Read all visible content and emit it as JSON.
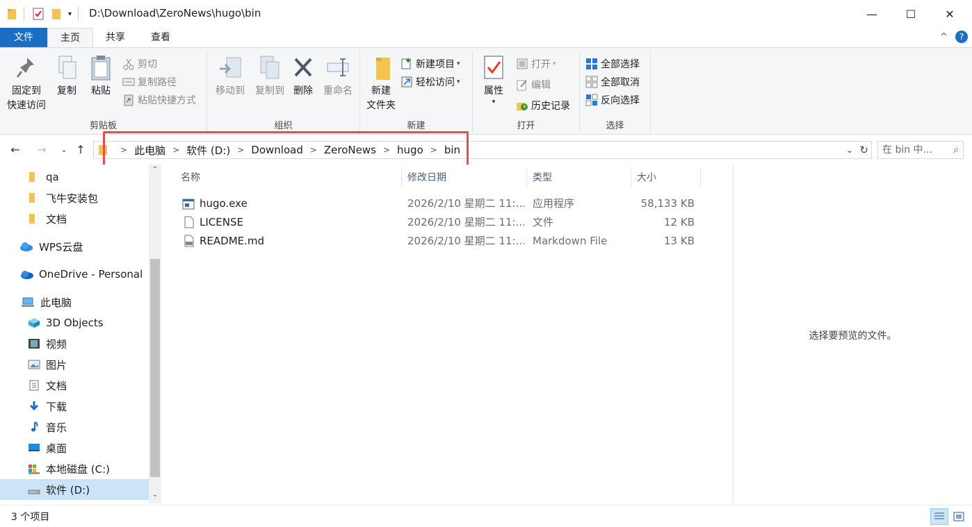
{
  "titlebar": {
    "path": "D:\\Download\\ZeroNews\\hugo\\bin",
    "minimize": "—",
    "maximize": "☐",
    "close": "✕"
  },
  "ribbon_tabs": {
    "file": "文件",
    "home": "主页",
    "share": "共享",
    "view": "查看",
    "collapse": "^",
    "help": "?"
  },
  "ribbon": {
    "clipboard": {
      "label": "剪贴板",
      "pin_line1": "固定到",
      "pin_line2": "快速访问",
      "copy": "复制",
      "paste": "粘贴",
      "cut": "剪切",
      "copy_path": "复制路径",
      "paste_shortcut": "粘贴快捷方式"
    },
    "organize": {
      "label": "组织",
      "move_to": "移动到",
      "copy_to": "复制到",
      "delete": "删除",
      "rename": "重命名"
    },
    "new": {
      "label": "新建",
      "new_folder_line1": "新建",
      "new_folder_line2": "文件夹",
      "new_item": "新建项目",
      "easy_access": "轻松访问"
    },
    "open": {
      "label": "打开",
      "properties": "属性",
      "open": "打开",
      "edit": "编辑",
      "history": "历史记录"
    },
    "select": {
      "label": "选择",
      "select_all": "全部选择",
      "select_none": "全部取消",
      "invert": "反向选择"
    }
  },
  "address": {
    "crumbs": [
      "此电脑",
      "软件 (D:)",
      "Download",
      "ZeroNews",
      "hugo",
      "bin"
    ],
    "search_placeholder": "在 bin 中..."
  },
  "sidebar": {
    "items": [
      {
        "label": "qa",
        "icon": "folder-icon"
      },
      {
        "label": "飞牛安装包",
        "icon": "folder-icon"
      },
      {
        "label": "文档",
        "icon": "folder-icon"
      },
      {
        "label": "WPS云盘",
        "icon": "cloud-icon"
      },
      {
        "label": "OneDrive - Personal",
        "icon": "onedrive-icon"
      },
      {
        "label": "此电脑",
        "icon": "computer-icon"
      },
      {
        "label": "3D Objects",
        "icon": "cube-icon"
      },
      {
        "label": "视频",
        "icon": "video-icon"
      },
      {
        "label": "图片",
        "icon": "picture-icon"
      },
      {
        "label": "文档",
        "icon": "document-icon"
      },
      {
        "label": "下载",
        "icon": "download-icon"
      },
      {
        "label": "音乐",
        "icon": "music-icon"
      },
      {
        "label": "桌面",
        "icon": "desktop-icon"
      },
      {
        "label": "本地磁盘 (C:)",
        "icon": "drive-c-icon"
      },
      {
        "label": "软件 (D:)",
        "icon": "drive-icon"
      }
    ]
  },
  "filelist": {
    "columns": [
      "名称",
      "修改日期",
      "类型",
      "大小"
    ],
    "rows": [
      {
        "name": "hugo.exe",
        "date": "2026/2/10 星期二 11:...",
        "type": "应用程序",
        "size": "58,133 KB",
        "icon": "exe-icon"
      },
      {
        "name": "LICENSE",
        "date": "2026/2/10 星期二 11:...",
        "type": "文件",
        "size": "12 KB",
        "icon": "file-icon"
      },
      {
        "name": "README.md",
        "date": "2026/2/10 星期二 11:...",
        "type": "Markdown File",
        "size": "13 KB",
        "icon": "markdown-icon"
      }
    ]
  },
  "preview": {
    "message": "选择要预览的文件。"
  },
  "status": {
    "count": "3 个项目"
  },
  "colors": {
    "accent": "#1a6fc4",
    "folder": "#f4c44e",
    "selection": "#cce4f7",
    "highlight_box": "#e05050"
  }
}
